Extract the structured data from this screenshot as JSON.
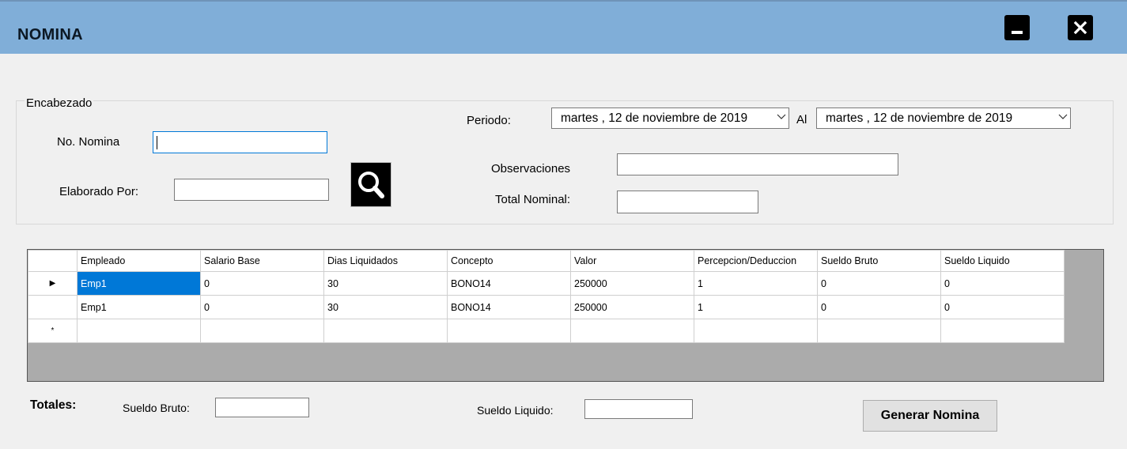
{
  "window": {
    "title": "NOMINA"
  },
  "header_group": {
    "legend": "Encabezado",
    "no_nomina_label": "No. Nomina",
    "no_nomina_value": "",
    "elaborado_label": "Elaborado Por:",
    "elaborado_value": "",
    "periodo_label": "Periodo:",
    "periodo_from": "martes   , 12 de noviembre de 2019",
    "al_label": "Al",
    "periodo_to": "martes   , 12 de noviembre de 2019",
    "observaciones_label": "Observaciones",
    "observaciones_value": "",
    "total_nominal_label": "Total Nominal:",
    "total_nominal_value": ""
  },
  "grid": {
    "columns": [
      "Empleado",
      "Salario Base",
      "Dias Liquidados",
      "Concepto",
      "Valor",
      "Percepcion/Deduccion",
      "Sueldo Bruto",
      "Sueldo Liquido"
    ],
    "rows": [
      [
        "Emp1",
        "0",
        "30",
        "BONO14",
        "250000",
        "1",
        "0",
        "0"
      ],
      [
        "Emp1",
        "0",
        "30",
        "BONO14",
        "250000",
        "1",
        "0",
        "0"
      ]
    ],
    "current_row_marker": "▶",
    "new_row_marker": "*"
  },
  "totals": {
    "label": "Totales:",
    "sueldo_bruto_label": "Sueldo Bruto:",
    "sueldo_bruto_value": "",
    "sueldo_liquido_label": "Sueldo Liquido:",
    "sueldo_liquido_value": ""
  },
  "actions": {
    "generar_label": "Generar Nomina"
  },
  "icons": {
    "minimize": "minimize-icon",
    "close": "close-icon",
    "search": "search-icon",
    "dropdown": "chevron-down-icon"
  },
  "colors": {
    "titlebar": "#80aed8",
    "selection": "#0078d7",
    "grid_background": "#ababab"
  }
}
